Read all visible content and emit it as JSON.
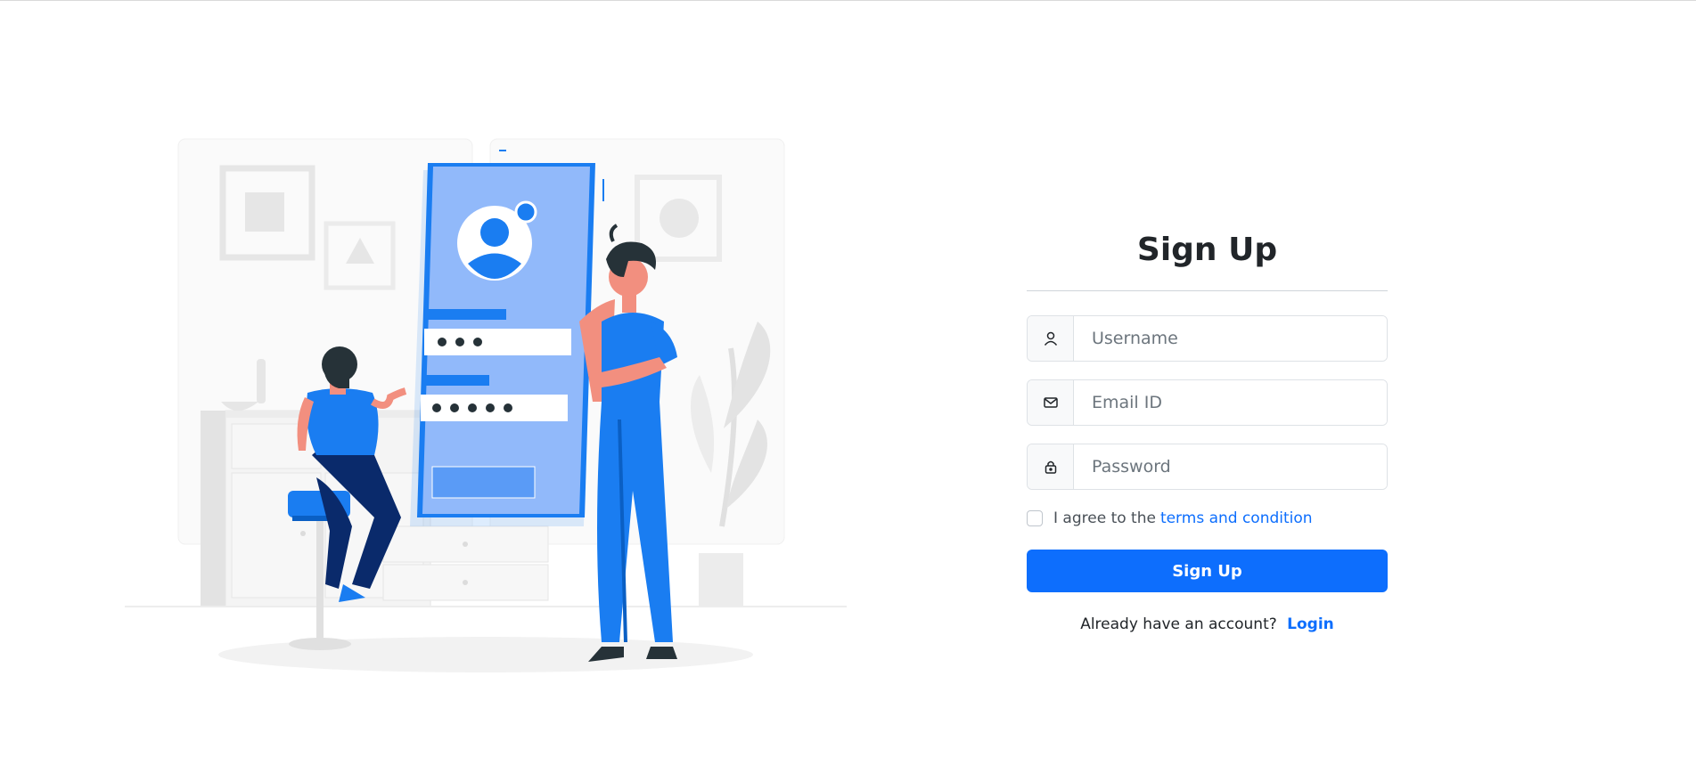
{
  "signup": {
    "title": "Sign Up",
    "username": {
      "placeholder": "Username",
      "icon": "user-icon"
    },
    "email": {
      "placeholder": "Email ID",
      "icon": "envelope-icon"
    },
    "password": {
      "placeholder": "Password",
      "icon": "lock-icon"
    },
    "agree_text": "I agree to the",
    "terms_link": "terms and condition",
    "submit_label": "Sign Up",
    "login_prompt": "Already have an account?",
    "login_link": "Login"
  },
  "colors": {
    "accent": "#0d6efd",
    "illustration_blue": "#1a7df1",
    "illustration_navy": "#0a2a6b"
  }
}
